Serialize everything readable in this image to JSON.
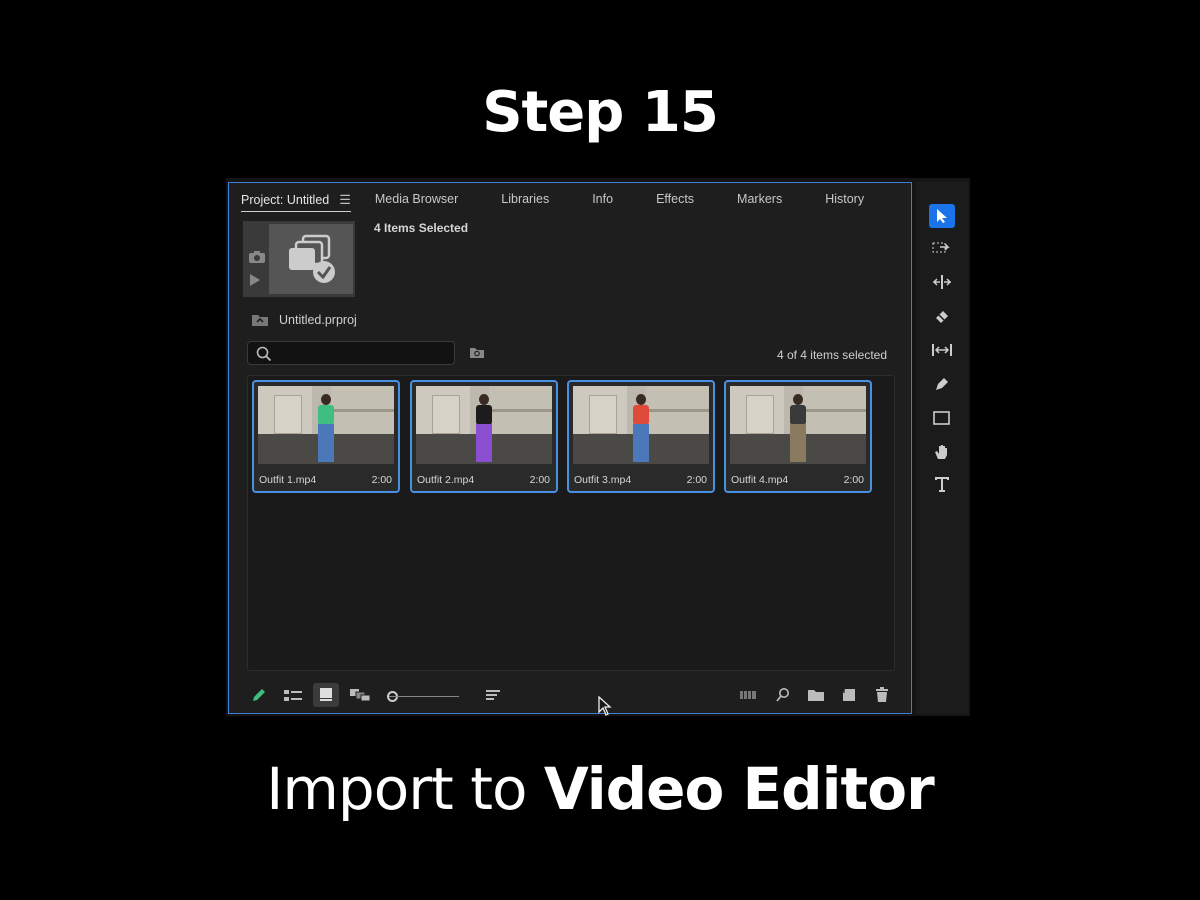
{
  "step_title": "Step 15",
  "caption": {
    "regular": "Import to ",
    "bold": "Video Editor"
  },
  "tabs": [
    {
      "label": "Project: Untitled",
      "active": true
    },
    {
      "label": "Media Browser"
    },
    {
      "label": "Libraries"
    },
    {
      "label": "Info"
    },
    {
      "label": "Effects"
    },
    {
      "label": "Markers"
    },
    {
      "label": "History"
    }
  ],
  "preview": {
    "title": "4 Items Selected"
  },
  "project_file": "Untitled.prproj",
  "search": {
    "value": ""
  },
  "selection_count": "4 of 4 items selected",
  "clips": [
    {
      "name": "Outfit 1.mp4",
      "duration": "2:00",
      "top_color": "#3fbf7f",
      "pants_color": "#4a78b8"
    },
    {
      "name": "Outfit 2.mp4",
      "duration": "2:00",
      "top_color": "#1c1c1c",
      "pants_color": "#8a4fd0"
    },
    {
      "name": "Outfit 3.mp4",
      "duration": "2:00",
      "top_color": "#e04a3a",
      "pants_color": "#4a78b8"
    },
    {
      "name": "Outfit 4.mp4",
      "duration": "2:00",
      "top_color": "#3a3a3a",
      "pants_color": "#8a7a60"
    }
  ],
  "colors": {
    "selection": "#4a90e2",
    "active_tool": "#1a73e8",
    "pencil": "#3fbf7f"
  }
}
